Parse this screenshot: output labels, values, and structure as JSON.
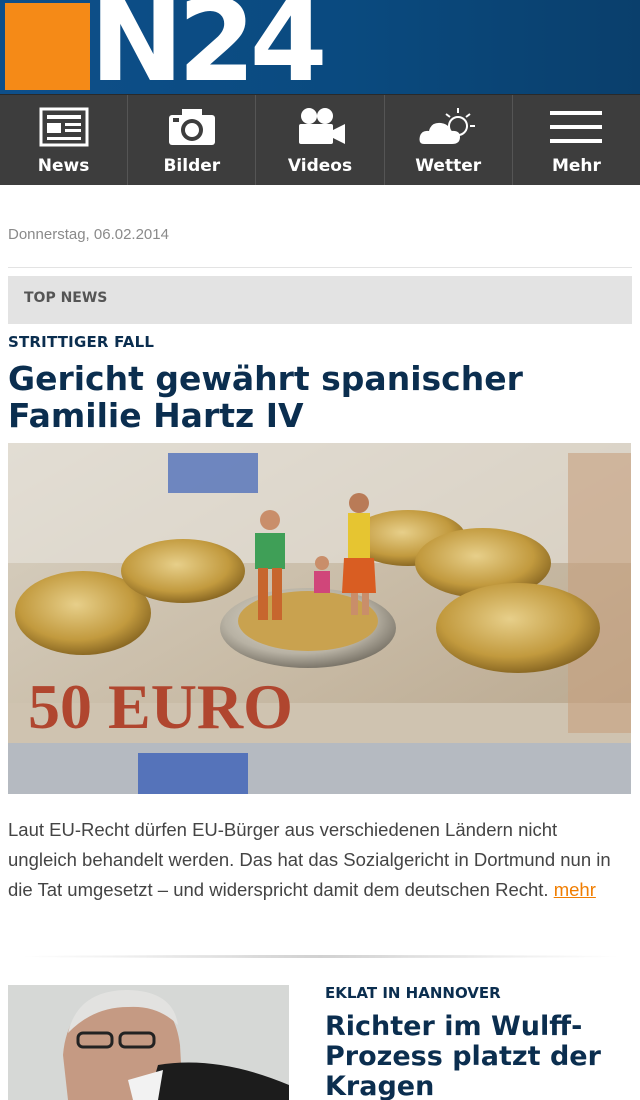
{
  "brand": {
    "logo_text": "N24",
    "accent_color": "#f58a17",
    "header_color": "#0e4f8a"
  },
  "nav": {
    "items": [
      {
        "label": "News",
        "icon": "newspaper-icon"
      },
      {
        "label": "Bilder",
        "icon": "camera-icon"
      },
      {
        "label": "Videos",
        "icon": "video-camera-icon"
      },
      {
        "label": "Wetter",
        "icon": "weather-icon"
      },
      {
        "label": "Mehr",
        "icon": "menu-icon"
      }
    ]
  },
  "main": {
    "date": "Donnerstag, 06.02.2014",
    "section_label": "TOP NEWS",
    "top_article": {
      "kicker": "STRITTIGER FALL",
      "headline": "Gericht gewährt spanischer Familie Hartz IV",
      "teaser": "Laut EU-Recht dürfen EU-Bürger aus verschiedenen Ländern nicht ungleich behandelt werden. Das hat das Sozialgericht in Dortmund nun in die Tat umgesetzt – und widerspricht damit dem deutschen Recht. ",
      "more_label": "mehr",
      "image_banknote_text": "50 EURO"
    },
    "second_article": {
      "kicker": "EKLAT IN HANNOVER",
      "headline": "Richter im Wulff-Prozess platzt der Kragen"
    }
  }
}
